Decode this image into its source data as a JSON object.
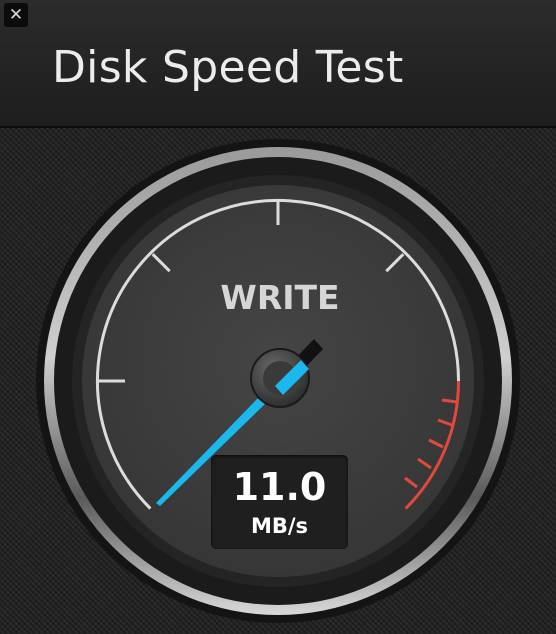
{
  "window": {
    "close_glyph": "✕",
    "title": "Disk Speed Test"
  },
  "gauge": {
    "mode_label": "WRITE",
    "value": "11.0",
    "unit": "MB/s",
    "needle_color": "#1ab8ec",
    "redline_color": "#e0493c",
    "tick_color": "#dcdcdc"
  }
}
